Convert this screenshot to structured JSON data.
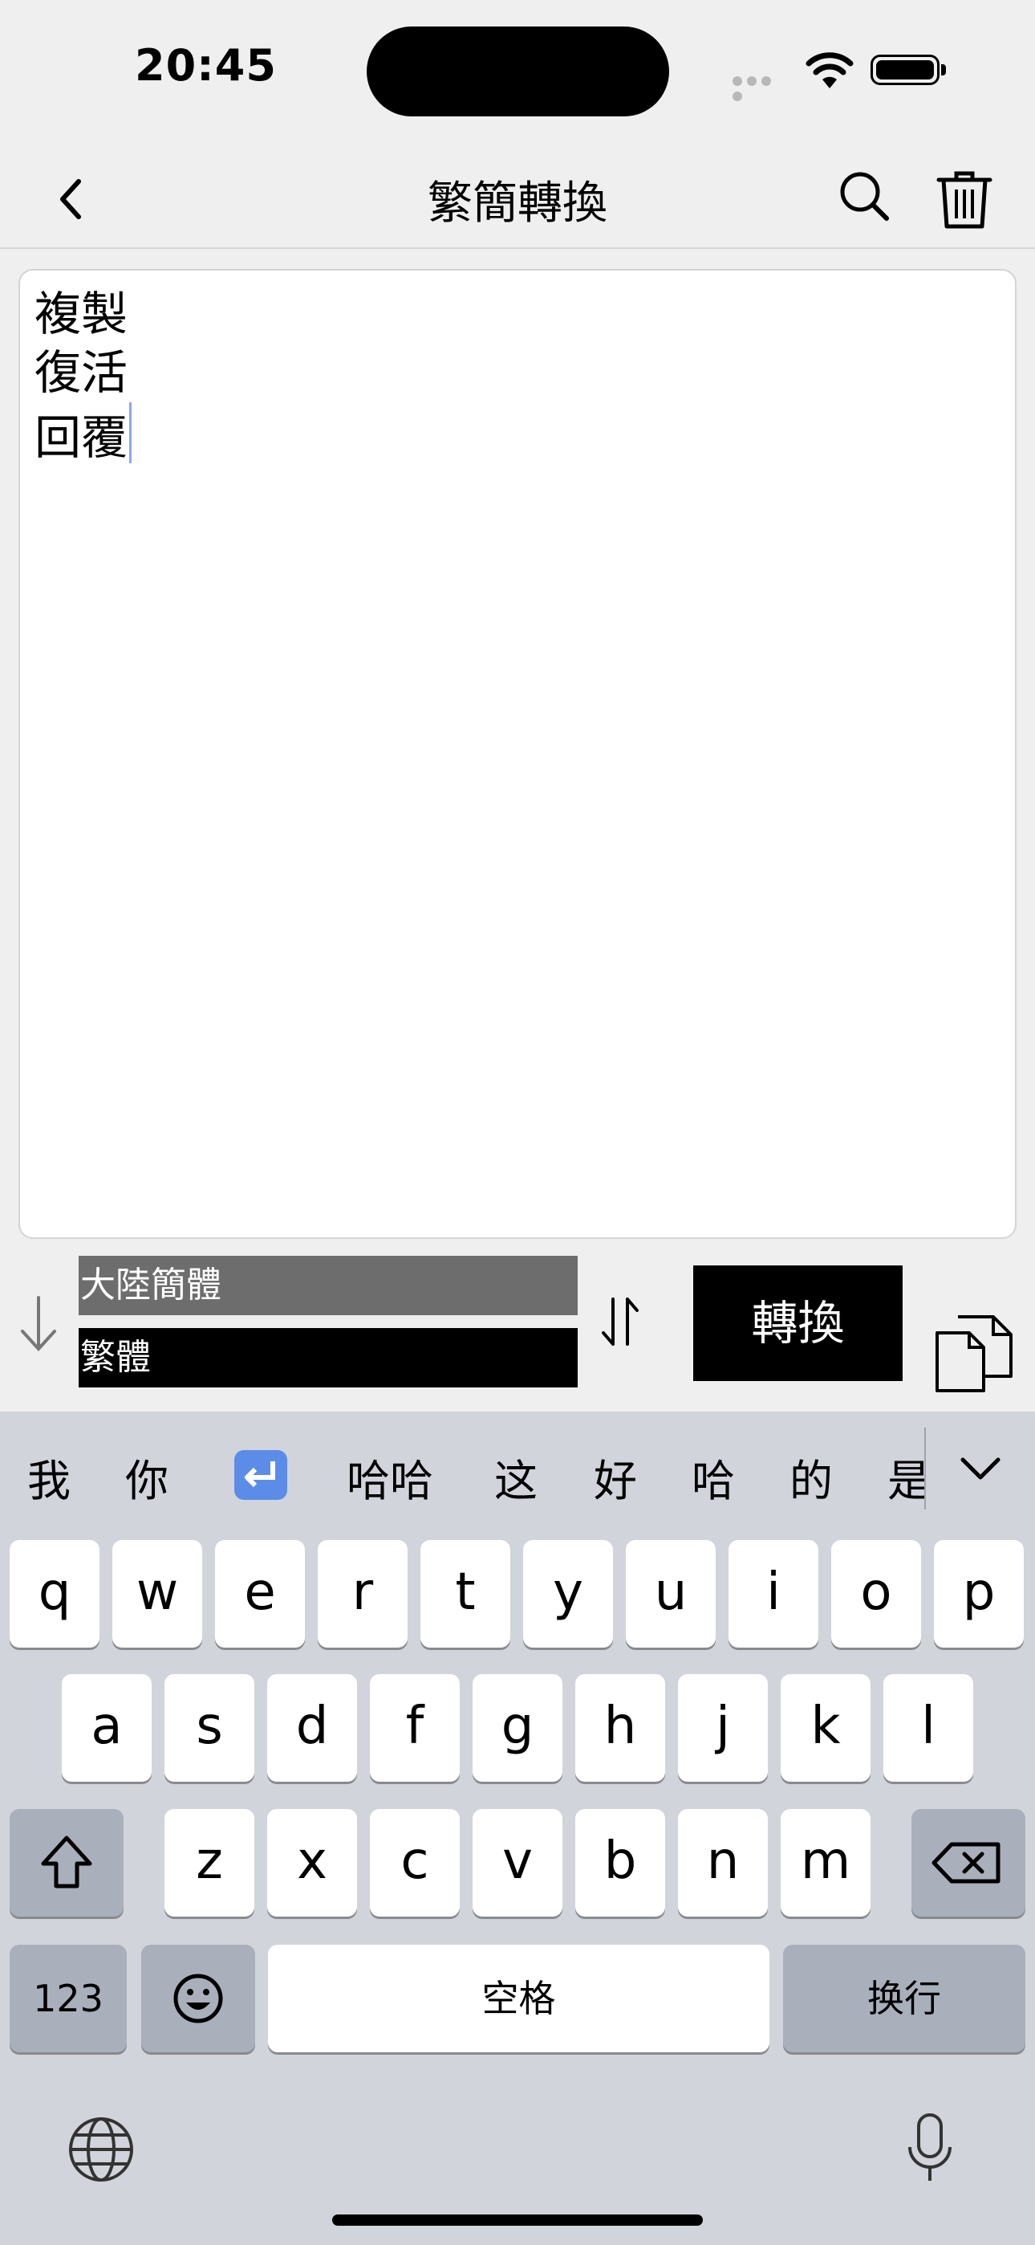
{
  "status": {
    "time": "20:45"
  },
  "nav": {
    "title": "繁簡轉換"
  },
  "editor": {
    "lines": [
      "複製",
      "復活",
      "回覆"
    ]
  },
  "controls": {
    "source_language": "大陸簡體",
    "target_language": "繁體",
    "convert_label": "轉換"
  },
  "keyboard": {
    "suggestions": [
      "我",
      "你",
      "哈哈",
      "这",
      "好",
      "哈",
      "的",
      "是"
    ],
    "row1": [
      "q",
      "w",
      "e",
      "r",
      "t",
      "y",
      "u",
      "i",
      "o",
      "p"
    ],
    "row2": [
      "a",
      "s",
      "d",
      "f",
      "g",
      "h",
      "j",
      "k",
      "l"
    ],
    "row3": [
      "z",
      "x",
      "c",
      "v",
      "b",
      "n",
      "m"
    ],
    "numbers_label": "123",
    "space_label": "空格",
    "return_label": "换行"
  }
}
